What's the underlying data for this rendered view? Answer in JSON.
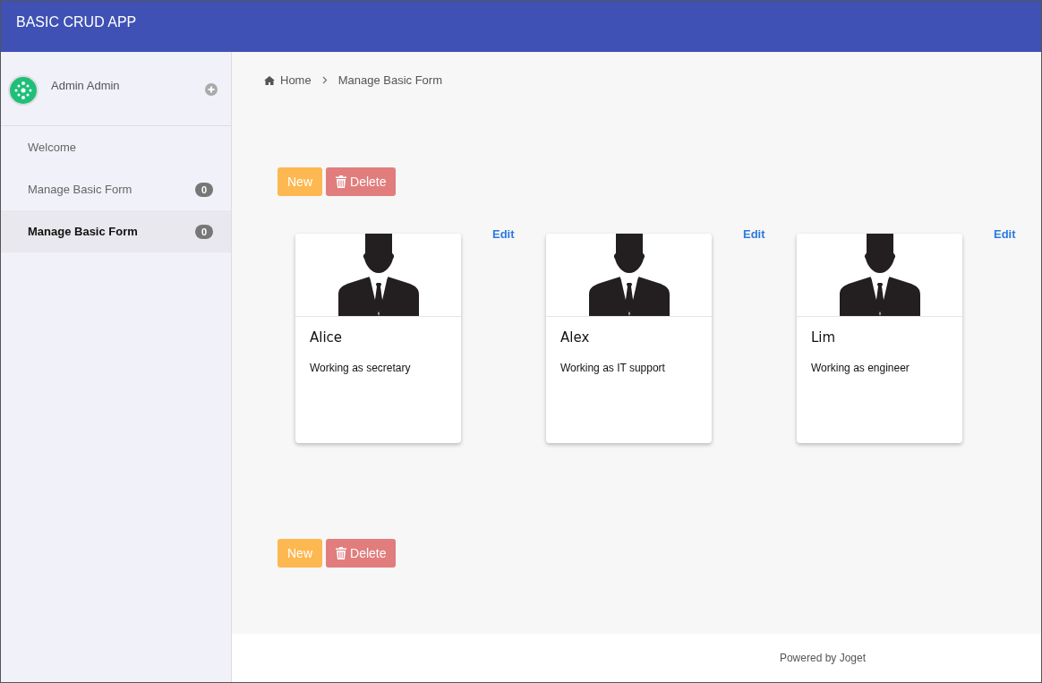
{
  "header": {
    "title": "BASIC CRUD APP"
  },
  "sidebar": {
    "user": {
      "name": "Admin Admin"
    },
    "items": [
      {
        "label": "Welcome",
        "selected": false
      },
      {
        "label": "Manage Basic Form",
        "badge": "0",
        "selected": false
      },
      {
        "label": "Manage Basic Form",
        "badge": "0",
        "selected": true
      }
    ]
  },
  "breadcrumb": [
    "Home",
    "Manage Basic Form"
  ],
  "toolbar_top": {
    "new": "New",
    "delete": "Delete"
  },
  "cards": [
    {
      "name": "Alice",
      "description": "Working as secretary",
      "edit": "Edit"
    },
    {
      "name": "Alex",
      "description": "Working as IT support",
      "edit": "Edit"
    },
    {
      "name": "Lim",
      "description": "Working as engineer",
      "edit": "Edit"
    }
  ],
  "toolbar_bottom": {
    "new": "New",
    "delete": "Delete"
  },
  "footer": "Powered by Joget"
}
